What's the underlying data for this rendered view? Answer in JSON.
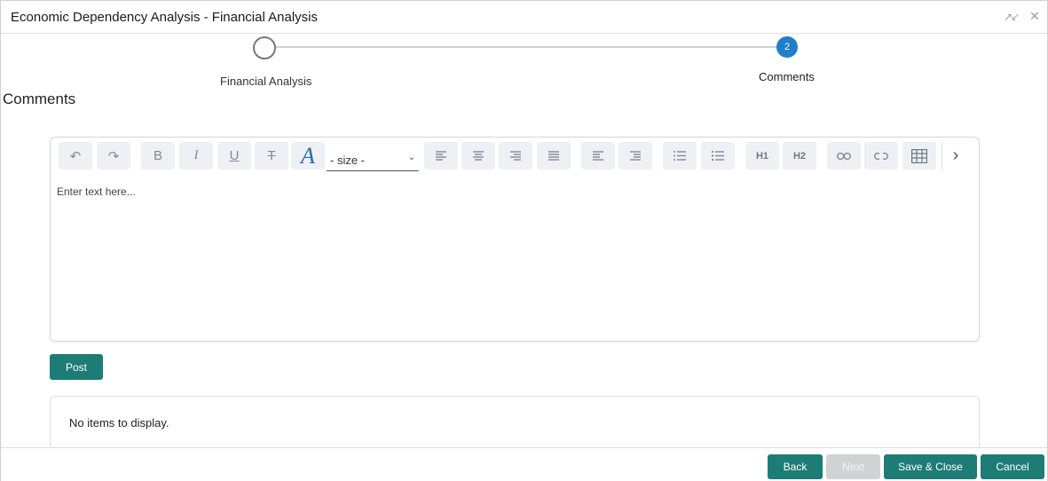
{
  "window": {
    "title": "Economic Dependency Analysis - Financial Analysis"
  },
  "icons": {
    "expand": "expand-icon",
    "close": "close-icon"
  },
  "stepper": {
    "steps": [
      {
        "label": "Financial Analysis",
        "number": "",
        "state": "inactive"
      },
      {
        "label": "Comments",
        "number": "2",
        "state": "active"
      }
    ]
  },
  "section": {
    "heading": "Comments"
  },
  "editor": {
    "size_value": "- size -",
    "placeholder": "Enter text here...",
    "toolbar": {
      "undo": "↶",
      "redo": "↷",
      "bold": "B",
      "italic": "I",
      "underline": "U",
      "strike": "T",
      "font": "A",
      "h1": "H1",
      "h2": "H2",
      "more": "›"
    }
  },
  "post_label": "Post",
  "list": {
    "empty_message": "No items to display."
  },
  "footer": {
    "back": "Back",
    "next": "Next",
    "save_close": "Save & Close",
    "cancel": "Cancel"
  },
  "colors": {
    "primary": "#1d7d76",
    "step_active": "#1f7fcb",
    "disabled": "#cfd3d4"
  }
}
